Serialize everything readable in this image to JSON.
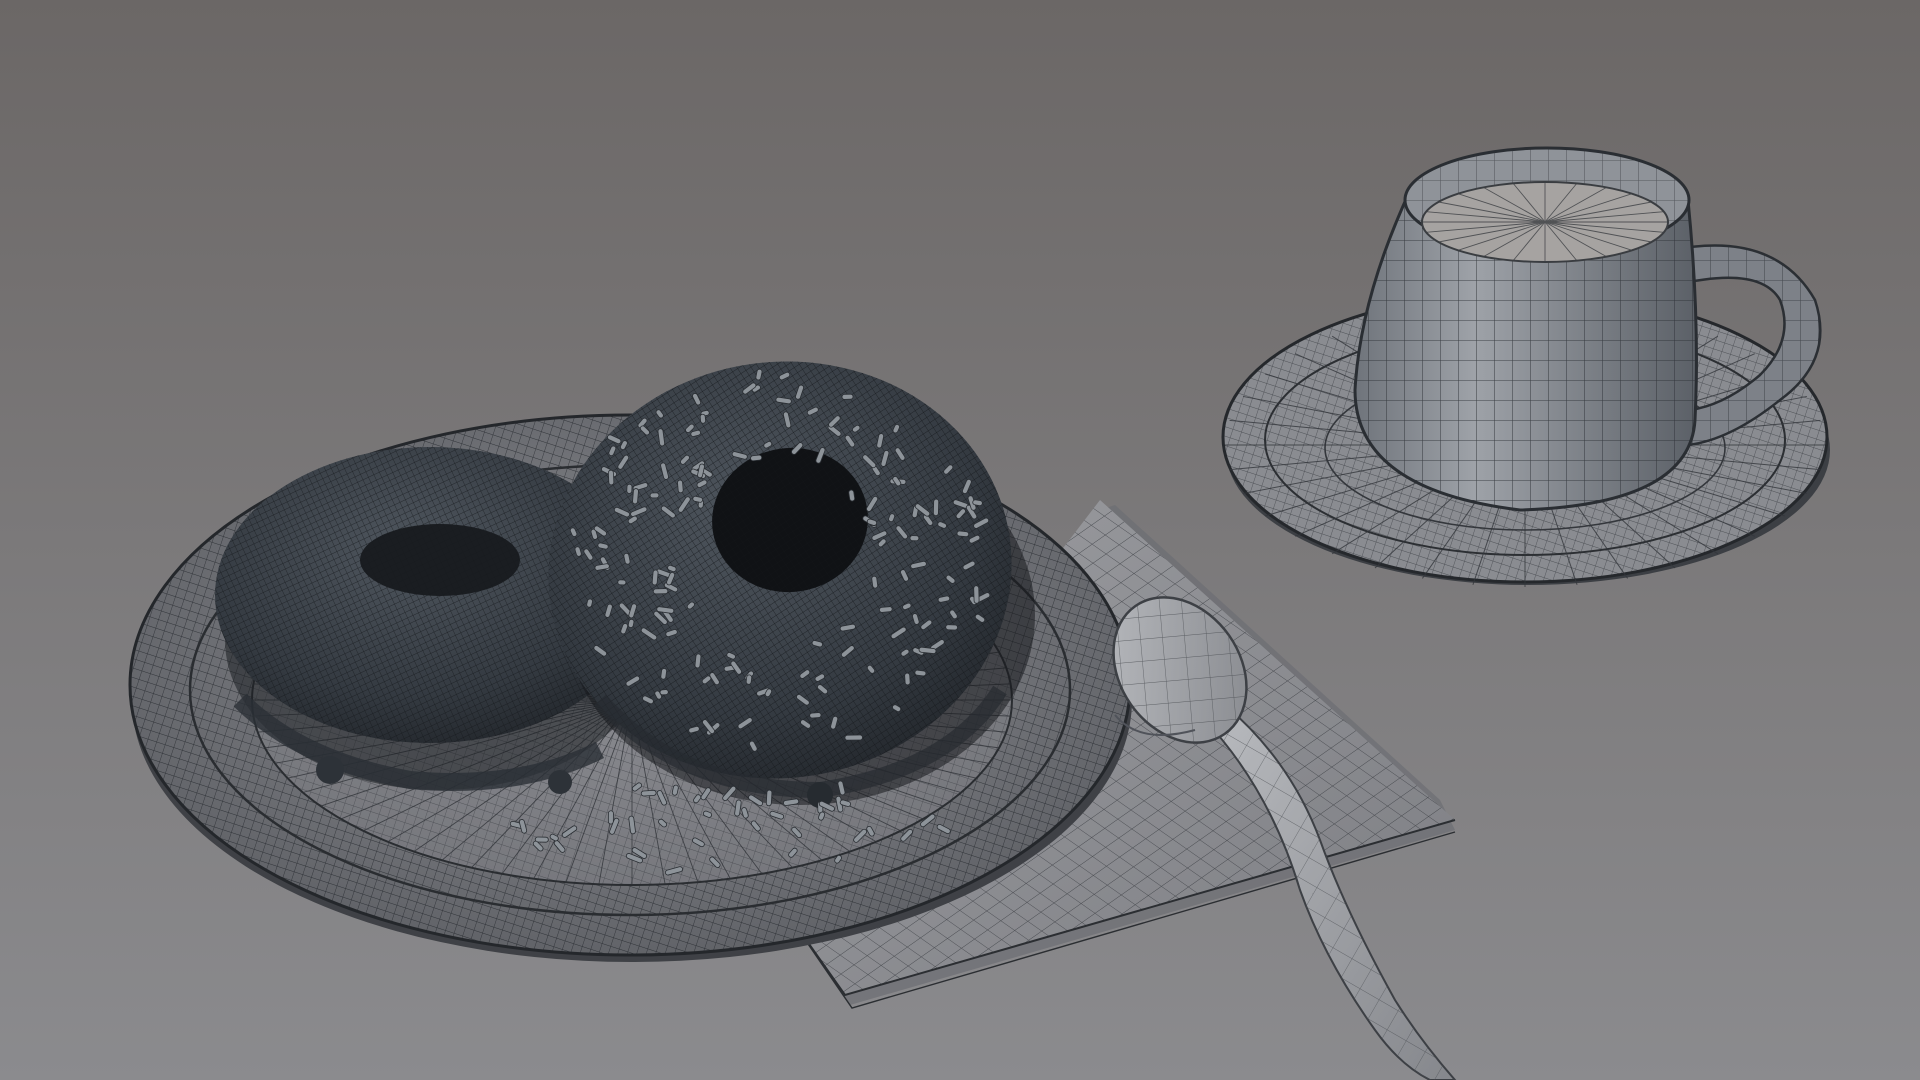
{
  "scene": {
    "style": "wireframe-render",
    "objects": [
      "plate",
      "donut-back",
      "donut-front",
      "sprinkles",
      "napkin",
      "spoon",
      "saucer",
      "cup",
      "coffee"
    ]
  },
  "colors": {
    "background_top": "#6b6766",
    "background_bottom": "#8a8a8d",
    "mesh_light": "#a5a6aa",
    "mesh_dark": "#2f3439",
    "donut_body": "#3b4148",
    "wire_dark": "#1b1e22",
    "wire_light": "#cfd0d4",
    "sprinkle": "#8d9399"
  }
}
